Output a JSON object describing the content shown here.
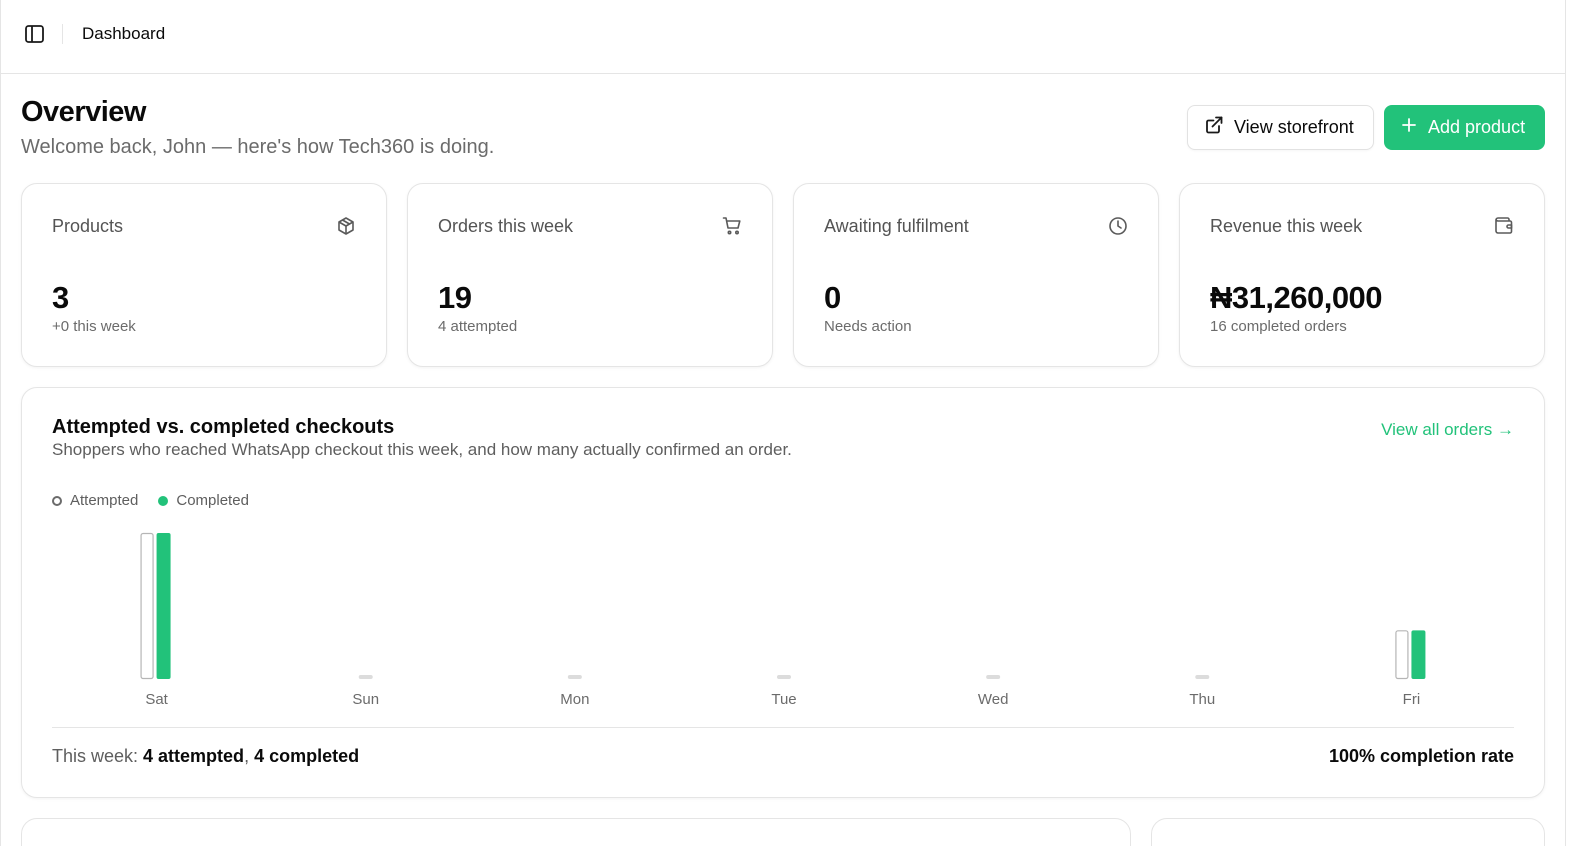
{
  "topbar": {
    "breadcrumb": "Dashboard",
    "sidebar_icon": "sidebar-toggle-icon"
  },
  "header": {
    "title": "Overview",
    "subtitle": "Welcome back, John — here's how Tech360 is doing.",
    "view_storefront_label": "View storefront",
    "add_product_label": "Add product"
  },
  "stats": [
    {
      "label": "Products",
      "value": "3",
      "note": "+0 this week",
      "icon": "box-icon"
    },
    {
      "label": "Orders this week",
      "value": "19",
      "note": "4 attempted",
      "icon": "cart-icon"
    },
    {
      "label": "Awaiting fulfilment",
      "value": "0",
      "note": "Needs action",
      "icon": "clock-icon"
    },
    {
      "label": "Revenue this week",
      "value": "₦31,260,000",
      "note": "16 completed orders",
      "icon": "wallet-icon"
    }
  ],
  "checkouts": {
    "title": "Attempted vs. completed checkouts",
    "subtitle": "Shoppers who reached WhatsApp checkout this week, and how many actually confirmed an order.",
    "view_all_label": "View all orders →",
    "summary_prefix": "This week: ",
    "summary_attempted": "4 attempted",
    "summary_sep": ", ",
    "summary_completed": "4 completed",
    "rate_label": "100% completion rate"
  },
  "chart_data": {
    "type": "bar",
    "categories": [
      "Sat",
      "Sun",
      "Mon",
      "Tue",
      "Wed",
      "Thu",
      "Fri"
    ],
    "series": [
      {
        "name": "Attempted",
        "values": [
          3,
          0,
          0,
          0,
          0,
          0,
          1
        ]
      },
      {
        "name": "Completed",
        "values": [
          3,
          0,
          0,
          0,
          0,
          0,
          1
        ]
      }
    ],
    "ylim": [
      0,
      3
    ],
    "legend": "top-left",
    "grid": false,
    "colors": {
      "attempted_fill": "#ffffff",
      "attempted_stroke": "#b5b5b5",
      "completed": "#22c27a",
      "zero_stub": "#dcdcdc"
    }
  }
}
